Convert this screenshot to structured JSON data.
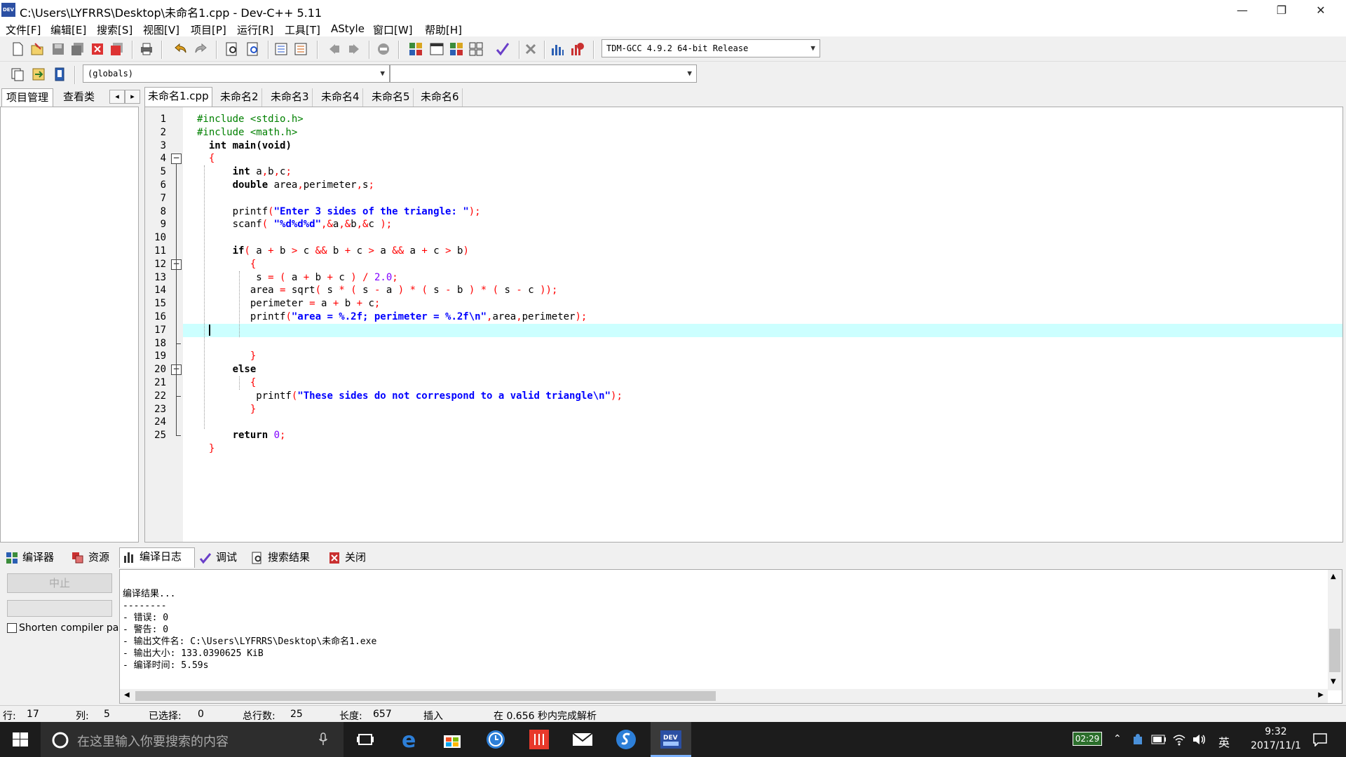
{
  "window": {
    "title": "C:\\Users\\LYFRRS\\Desktop\\未命名1.cpp - Dev-C++ 5.11",
    "icon_label": "DEV",
    "minimize": "—",
    "restore": "❐",
    "close": "✕"
  },
  "menu": [
    "文件[F]",
    "编辑[E]",
    "搜索[S]",
    "视图[V]",
    "项目[P]",
    "运行[R]",
    "工具[T]",
    "AStyle",
    "窗口[W]",
    "帮助[H]"
  ],
  "toolbar": {
    "compiler_select": "TDM-GCC 4.9.2 64-bit Release",
    "scope_select": "(globals)",
    "member_select": ""
  },
  "left_tabs": [
    "项目管理",
    "查看类"
  ],
  "left_nav": [
    "◂",
    "▸"
  ],
  "editor_tabs": [
    "未命名1.cpp",
    "未命名2",
    "未命名3",
    "未命名4",
    "未命名5",
    "未命名6"
  ],
  "code_lines": [
    [
      {
        "t": "#include <stdio.h>",
        "c": "pp"
      }
    ],
    [
      {
        "t": "#include <math.h>",
        "c": "pp"
      }
    ],
    [
      {
        "t": "  "
      },
      {
        "t": "int",
        "c": "kw"
      },
      {
        "t": " "
      },
      {
        "t": "main",
        "c": "kw"
      },
      {
        "t": "(",
        "c": "kw"
      },
      {
        "t": "void",
        "c": "kw"
      },
      {
        "t": ")",
        "c": "kw"
      }
    ],
    [
      {
        "t": "  "
      },
      {
        "t": "{",
        "c": "sym"
      }
    ],
    [
      {
        "t": "      "
      },
      {
        "t": "int",
        "c": "kw"
      },
      {
        "t": " a"
      },
      {
        "t": ",",
        "c": "sym"
      },
      {
        "t": "b"
      },
      {
        "t": ",",
        "c": "sym"
      },
      {
        "t": "c"
      },
      {
        "t": ";",
        "c": "sym"
      }
    ],
    [
      {
        "t": "      "
      },
      {
        "t": "double",
        "c": "kw"
      },
      {
        "t": " area"
      },
      {
        "t": ",",
        "c": "sym"
      },
      {
        "t": "perimeter"
      },
      {
        "t": ",",
        "c": "sym"
      },
      {
        "t": "s"
      },
      {
        "t": ";",
        "c": "sym"
      }
    ],
    [
      {
        "t": ""
      }
    ],
    [
      {
        "t": "      printf"
      },
      {
        "t": "(",
        "c": "sym"
      },
      {
        "t": "\"Enter 3 sides of the triangle: \"",
        "c": "str"
      },
      {
        "t": ");",
        "c": "sym"
      }
    ],
    [
      {
        "t": "      scanf"
      },
      {
        "t": "(",
        "c": "sym"
      },
      {
        "t": " "
      },
      {
        "t": "\"%d%d%d\"",
        "c": "str"
      },
      {
        "t": ",&",
        "c": "sym"
      },
      {
        "t": "a"
      },
      {
        "t": ",&",
        "c": "sym"
      },
      {
        "t": "b"
      },
      {
        "t": ",&",
        "c": "sym"
      },
      {
        "t": "c "
      },
      {
        "t": ");",
        "c": "sym"
      }
    ],
    [
      {
        "t": ""
      }
    ],
    [
      {
        "t": "      "
      },
      {
        "t": "if",
        "c": "kw"
      },
      {
        "t": "(",
        "c": "sym"
      },
      {
        "t": " a "
      },
      {
        "t": "+",
        "c": "sym"
      },
      {
        "t": " b "
      },
      {
        "t": ">",
        "c": "sym"
      },
      {
        "t": " c "
      },
      {
        "t": "&&",
        "c": "sym"
      },
      {
        "t": " b "
      },
      {
        "t": "+",
        "c": "sym"
      },
      {
        "t": " c "
      },
      {
        "t": ">",
        "c": "sym"
      },
      {
        "t": " a "
      },
      {
        "t": "&&",
        "c": "sym"
      },
      {
        "t": " a "
      },
      {
        "t": "+",
        "c": "sym"
      },
      {
        "t": " c "
      },
      {
        "t": ">",
        "c": "sym"
      },
      {
        "t": " b"
      },
      {
        "t": ")",
        "c": "sym"
      }
    ],
    [
      {
        "t": "         "
      },
      {
        "t": "{",
        "c": "sym"
      }
    ],
    [
      {
        "t": "          s "
      },
      {
        "t": "=",
        "c": "sym"
      },
      {
        "t": " "
      },
      {
        "t": "(",
        "c": "sym"
      },
      {
        "t": " a "
      },
      {
        "t": "+",
        "c": "sym"
      },
      {
        "t": " b "
      },
      {
        "t": "+",
        "c": "sym"
      },
      {
        "t": " c "
      },
      {
        "t": ")",
        "c": "sym"
      },
      {
        "t": " "
      },
      {
        "t": "/",
        "c": "sym"
      },
      {
        "t": " "
      },
      {
        "t": "2.0",
        "c": "num"
      },
      {
        "t": ";",
        "c": "sym"
      }
    ],
    [
      {
        "t": "         area "
      },
      {
        "t": "=",
        "c": "sym"
      },
      {
        "t": " sqrt"
      },
      {
        "t": "(",
        "c": "sym"
      },
      {
        "t": " s "
      },
      {
        "t": "*",
        "c": "sym"
      },
      {
        "t": " "
      },
      {
        "t": "(",
        "c": "sym"
      },
      {
        "t": " s "
      },
      {
        "t": "-",
        "c": "sym"
      },
      {
        "t": " a "
      },
      {
        "t": ")",
        "c": "sym"
      },
      {
        "t": " "
      },
      {
        "t": "*",
        "c": "sym"
      },
      {
        "t": " "
      },
      {
        "t": "(",
        "c": "sym"
      },
      {
        "t": " s "
      },
      {
        "t": "-",
        "c": "sym"
      },
      {
        "t": " b "
      },
      {
        "t": ")",
        "c": "sym"
      },
      {
        "t": " "
      },
      {
        "t": "*",
        "c": "sym"
      },
      {
        "t": " "
      },
      {
        "t": "(",
        "c": "sym"
      },
      {
        "t": " s "
      },
      {
        "t": "-",
        "c": "sym"
      },
      {
        "t": " c "
      },
      {
        "t": "));",
        "c": "sym"
      }
    ],
    [
      {
        "t": "         perimeter "
      },
      {
        "t": "=",
        "c": "sym"
      },
      {
        "t": " a "
      },
      {
        "t": "+",
        "c": "sym"
      },
      {
        "t": " b "
      },
      {
        "t": "+",
        "c": "sym"
      },
      {
        "t": " c"
      },
      {
        "t": ";",
        "c": "sym"
      }
    ],
    [
      {
        "t": "         printf"
      },
      {
        "t": "(",
        "c": "sym"
      },
      {
        "t": "\"area = %.2f; perimeter = %.2f\\n\"",
        "c": "str"
      },
      {
        "t": ",",
        "c": "sym"
      },
      {
        "t": "area"
      },
      {
        "t": ",",
        "c": "sym"
      },
      {
        "t": "perimeter"
      },
      {
        "t": ");",
        "c": "sym"
      }
    ],
    [
      {
        "t": "  "
      }
    ],
    [
      {
        "t": ""
      }
    ],
    [
      {
        "t": "         "
      },
      {
        "t": "}",
        "c": "sym"
      }
    ],
    [
      {
        "t": "      "
      },
      {
        "t": "else",
        "c": "kw"
      }
    ],
    [
      {
        "t": "         "
      },
      {
        "t": "{",
        "c": "sym"
      }
    ],
    [
      {
        "t": "          printf"
      },
      {
        "t": "(",
        "c": "sym"
      },
      {
        "t": "\"These sides do not correspond to a valid triangle\\n\"",
        "c": "str"
      },
      {
        "t": ");",
        "c": "sym"
      }
    ],
    [
      {
        "t": "         "
      },
      {
        "t": "}",
        "c": "sym"
      }
    ],
    [
      {
        "t": ""
      }
    ],
    [
      {
        "t": "      "
      },
      {
        "t": "return",
        "c": "kw"
      },
      {
        "t": " "
      },
      {
        "t": "0",
        "c": "num"
      },
      {
        "t": ";",
        "c": "sym"
      }
    ],
    [
      {
        "t": "  "
      },
      {
        "t": "}",
        "c": "sym"
      }
    ]
  ],
  "line_numbers": [
    "1",
    "2",
    "3",
    "4",
    "5",
    "6",
    "7",
    "8",
    "9",
    "10",
    "11",
    "12",
    "13",
    "14",
    "15",
    "16",
    "17",
    "18",
    "19",
    "20",
    "21",
    "22",
    "23",
    "24",
    "25"
  ],
  "current_line": 17,
  "bottom_tabs": [
    "编译器",
    "资源",
    "编译日志",
    "调试",
    "搜索结果",
    "关闭"
  ],
  "bottom_left": {
    "stop_label": "中止",
    "shorten_label": "Shorten compiler pa"
  },
  "compile_log": [
    "编译结果...",
    "--------",
    "- 错误: 0",
    "- 警告: 0",
    "- 输出文件名: C:\\Users\\LYFRRS\\Desktop\\未命名1.exe",
    "- 输出大小: 133.0390625 KiB",
    "- 编译时间: 5.59s"
  ],
  "status": {
    "row_label": "行:",
    "row": "17",
    "col_label": "列:",
    "col": "5",
    "sel_label": "已选择:",
    "sel": "0",
    "total_label": "总行数:",
    "total": "25",
    "len_label": "长度:",
    "len": "657",
    "mode": "插入",
    "parse": "在 0.656 秒内完成解析"
  },
  "taskbar": {
    "search_placeholder": "在这里输入你要搜索的内容",
    "battery_time": "02:29",
    "lang": "英",
    "time": "9:32",
    "date": "2017/11/1"
  },
  "colors": {
    "current_line": "#ccffff",
    "preprocessor": "#008000",
    "string": "#0000ff",
    "symbol": "#ff0000",
    "number": "#8000ff"
  }
}
